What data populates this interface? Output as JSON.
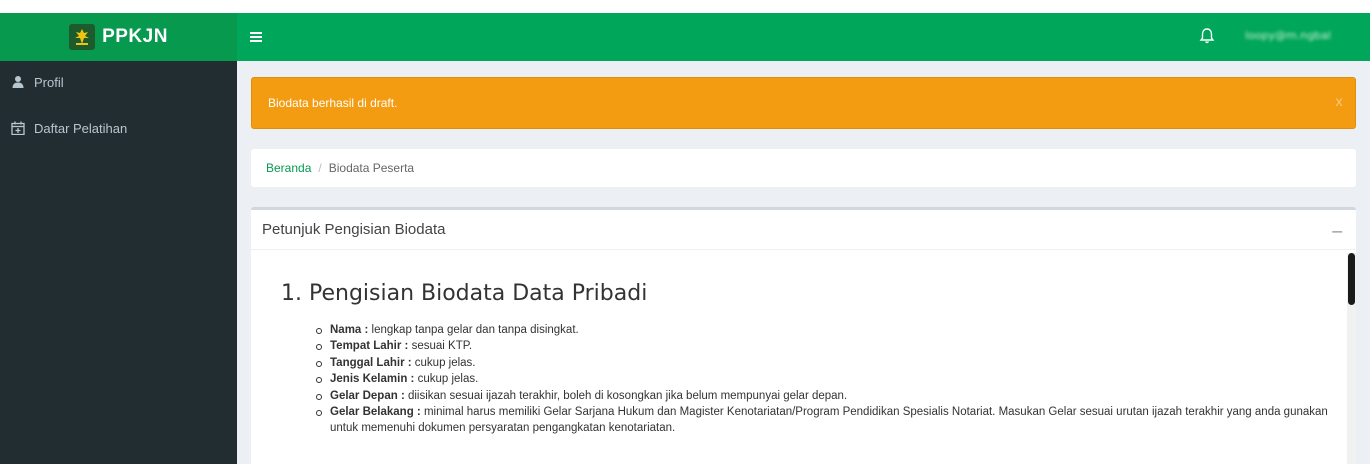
{
  "brand": {
    "name": "PPKJN"
  },
  "header": {
    "username": "loopy@m.ngbal"
  },
  "sidebar": {
    "items": [
      {
        "label": "Profil"
      },
      {
        "label": "Daftar Pelatihan"
      }
    ]
  },
  "alert": {
    "message": "Biodata berhasil di draft.",
    "close": "x"
  },
  "breadcrumb": {
    "home": "Beranda",
    "separator": "/",
    "current": "Biodata Peserta"
  },
  "panel": {
    "title": "Petunjuk Pengisian Biodata",
    "collapse": "−",
    "section_title": "1. Pengisian Biodata Data Pribadi",
    "rules": [
      {
        "term": "Nama :",
        "text": " lengkap tanpa gelar dan tanpa disingkat."
      },
      {
        "term": "Tempat Lahir :",
        "text": " sesuai KTP."
      },
      {
        "term": "Tanggal Lahir :",
        "text": " cukup jelas."
      },
      {
        "term": "Jenis Kelamin :",
        "text": " cukup jelas."
      },
      {
        "term": "Gelar Depan :",
        "text": " diisikan sesuai ijazah terakhir, boleh di kosongkan jika belum mempunyai gelar depan."
      },
      {
        "term": "Gelar Belakang :",
        "text": " minimal harus memiliki Gelar Sarjana Hukum dan Magister Kenotariatan/Program Pendidikan Spesialis Notariat. Masukan Gelar sesuai urutan ijazah terakhir yang anda gunakan untuk memenuhi dokumen persyaratan pengangkatan kenotariatan."
      }
    ]
  },
  "colors": {
    "brand_green": "#079a4f",
    "navbar_green": "#00a65a",
    "sidebar_bg": "#222d32",
    "alert_warning": "#f39c12"
  },
  "icons": {
    "menu": "hamburger-icon",
    "notification": "bell-icon",
    "profile": "user-icon",
    "training": "calendar-plus-icon"
  }
}
